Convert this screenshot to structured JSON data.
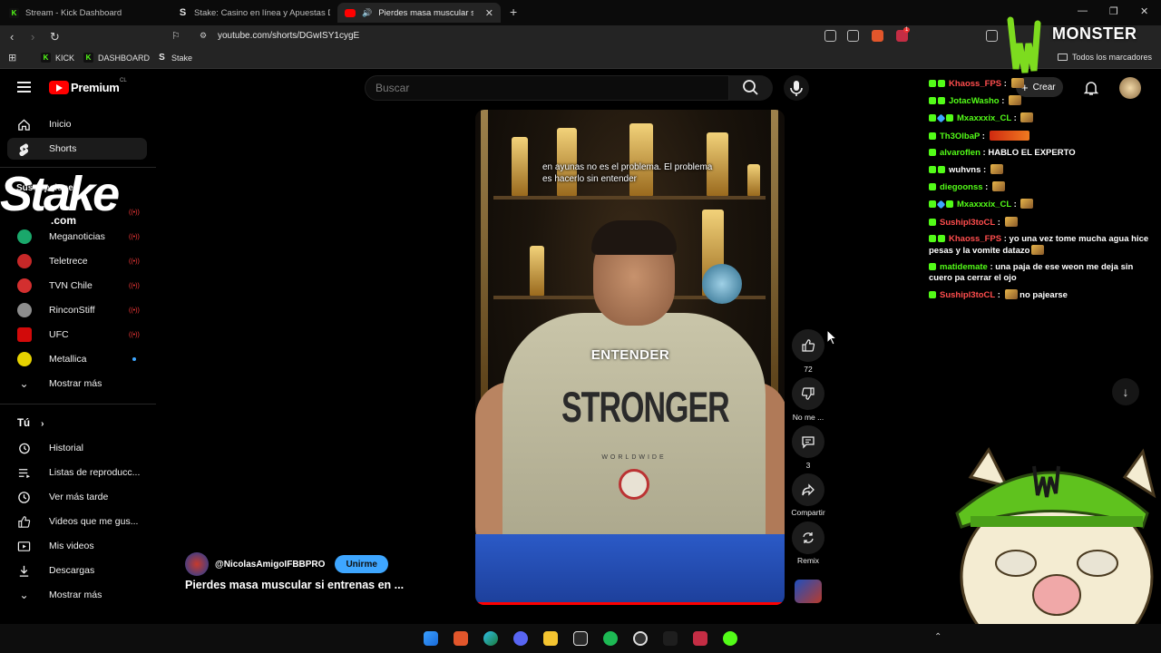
{
  "browser": {
    "tabs": [
      {
        "title": "Stream - Kick Dashboard",
        "favicon": "kick-icon"
      },
      {
        "title": "Stake: Casino en línea y Apuestas De",
        "favicon": "stake-icon"
      },
      {
        "title": "Pierdes masa muscular si ent",
        "favicon": "youtube-icon",
        "active": true
      }
    ],
    "url": "youtube.com/shorts/DGwISY1cygE",
    "bookmarks": [
      "KICK",
      "DASHBOARD",
      "Stake"
    ],
    "all_bookmarks": "Todos los marcadores",
    "extension_badge": "1"
  },
  "youtube": {
    "brand": "Premium",
    "country": "CL",
    "search_placeholder": "Buscar",
    "create_label": "Crear",
    "nav": [
      {
        "label": "Inicio",
        "icon": "home-icon"
      },
      {
        "label": "Shorts",
        "icon": "shorts-icon",
        "active": true
      }
    ],
    "subscriptions_heading": "Suscripciones",
    "subscriptions": [
      {
        "label": "Meganoticias",
        "live": true,
        "color": "#1aa86b"
      },
      {
        "label": "Teletrece",
        "live": true,
        "color": "#c62828"
      },
      {
        "label": "TVN Chile",
        "live": true,
        "color": "#d32f2f"
      },
      {
        "label": "RinconStiff",
        "live": true,
        "color": "#8d8d8d"
      },
      {
        "label": "UFC",
        "live": true,
        "color": "#d20a0a"
      },
      {
        "label": "Metallica",
        "live": false,
        "color": "#e6d200"
      }
    ],
    "show_more": "Mostrar más",
    "you_heading": "Tú",
    "you_items": [
      {
        "label": "Historial",
        "icon": "history-icon"
      },
      {
        "label": "Listas de reproducc...",
        "icon": "playlist-icon"
      },
      {
        "label": "Ver más tarde",
        "icon": "clock-icon"
      },
      {
        "label": "Videos que me gus...",
        "icon": "thumbs-up-icon"
      },
      {
        "label": "Mis videos",
        "icon": "video-icon"
      },
      {
        "label": "Descargas",
        "icon": "download-icon"
      }
    ],
    "show_more_2": "Mostrar más"
  },
  "short": {
    "caption_line1": "en ayunas no es el problema. El problema",
    "caption_line2": "es hacerlo sin entender",
    "burned_word": "ENTENDER",
    "shirt_text": "STRONGER",
    "shirt_sub": "WORLDWIDE",
    "channel": "@NicolasAmigoIFBBPRO",
    "join_label": "Unirme",
    "title": "Pierdes masa muscular si entrenas en ...",
    "likes": "72",
    "dislike_label": "No me ...",
    "comments": "3",
    "share_label": "Compartir",
    "remix_label": "Remix"
  },
  "overlay": {
    "stake_word": "Stake",
    "stake_com": ".com",
    "monster_word": "MONSTER",
    "chat": [
      {
        "user": "Khaoss_FPS",
        "color": "#ff4d4d",
        "badges": [
          "k",
          "k"
        ],
        "text": "",
        "emote": true
      },
      {
        "user": "JotacWasho",
        "color": "#53fc18",
        "badges": [
          "k",
          "k"
        ],
        "text": "",
        "emote": true
      },
      {
        "user": "Mxaxxxix_CL",
        "color": "#53fc18",
        "badges": [
          "k",
          "d",
          "k"
        ],
        "text": "",
        "emote": true
      },
      {
        "user": "Th3OlbaP",
        "color": "#53fc18",
        "badges": [
          "k"
        ],
        "text": "",
        "emote_red": true
      },
      {
        "user": "alvaroflen",
        "color": "#53fc18",
        "badges": [
          "k"
        ],
        "text": "HABLO EL EXPERTO"
      },
      {
        "user": "wuhvns",
        "color": "#fff",
        "badges": [
          "k",
          "k"
        ],
        "text": "",
        "emote": true
      },
      {
        "user": "diegoonss",
        "color": "#53fc18",
        "badges": [
          "k"
        ],
        "text": "",
        "emote": true
      },
      {
        "user": "Mxaxxxix_CL",
        "color": "#53fc18",
        "badges": [
          "k",
          "d",
          "k"
        ],
        "text": "",
        "emote": true
      },
      {
        "user": "Sushipl3toCL",
        "color": "#ff4d4d",
        "badges": [
          "k"
        ],
        "text": "",
        "emote": true
      },
      {
        "user": "Khaoss_FPS",
        "color": "#ff4d4d",
        "badges": [
          "k",
          "k"
        ],
        "text": "yo una vez tome mucha agua hice pesas y la vomite datazo",
        "emote": true
      },
      {
        "user": "matidemate",
        "color": "#53fc18",
        "badges": [
          "k"
        ],
        "text": "una paja de ese weon me deja sin cuero pa cerrar el ojo"
      },
      {
        "user": "Sushipl3toCL",
        "color": "#ff4d4d",
        "badges": [
          "k"
        ],
        "text": "no pajearse",
        "emote_before": true
      }
    ]
  }
}
